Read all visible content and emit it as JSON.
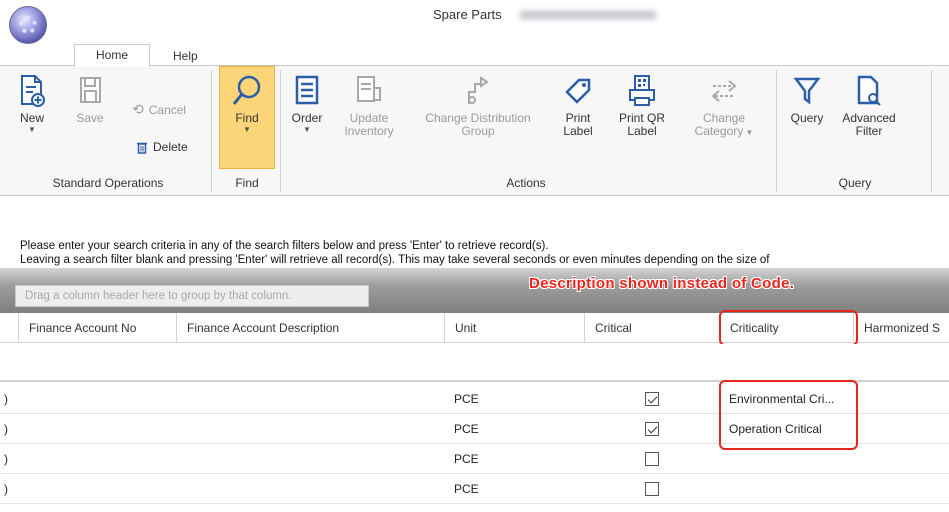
{
  "window": {
    "title": "Spare Parts",
    "app_icon": "gear-orb-icon"
  },
  "tabs": [
    {
      "label": "Home",
      "active": true
    },
    {
      "label": "Help",
      "active": false
    }
  ],
  "ribbon": {
    "standard_operations": {
      "group_label": "Standard Operations",
      "new": {
        "label": "New",
        "icon": "new-document-icon"
      },
      "save": {
        "label": "Save",
        "icon": "save-icon",
        "disabled": true
      },
      "cancel": {
        "label": "Cancel",
        "icon": "undo-icon",
        "disabled": true
      },
      "delete": {
        "label": "Delete",
        "icon": "trash-icon"
      }
    },
    "find": {
      "group_label": "Find",
      "find": {
        "label": "Find",
        "icon": "search-icon"
      }
    },
    "actions": {
      "group_label": "Actions",
      "order": {
        "label": "Order",
        "icon": "order-list-icon"
      },
      "update_inventory": {
        "label1": "Update",
        "label2": "Inventory",
        "icon": "update-inventory-icon",
        "disabled": true
      },
      "change_distribution_group": {
        "label1": "Change Distribution",
        "label2": "Group",
        "icon": "distribution-icon",
        "disabled": true
      },
      "print_label": {
        "label1": "Print",
        "label2": "Label",
        "icon": "tag-icon"
      },
      "print_qr_label": {
        "label1": "Print QR",
        "label2": "Label",
        "icon": "qr-printer-icon"
      },
      "change_category": {
        "label1": "Change",
        "label2": "Category",
        "icon": "swap-arrows-icon",
        "disabled": true
      }
    },
    "query": {
      "group_label": "Query",
      "query": {
        "label": "Query",
        "icon": "filter-funnel-icon"
      },
      "advanced_filter": {
        "label1": "Advanced",
        "label2": "Filter",
        "icon": "advanced-filter-icon"
      }
    }
  },
  "info": {
    "line1": "Please enter your search criteria in any of the search filters below and press  'Enter' to retrieve record(s).",
    "line2": "Leaving a search filter blank and pressing 'Enter'  will retrieve all record(s). This may take several seconds or even minutes depending on the size of"
  },
  "grid": {
    "group_hint": "Drag a column header here to group by that column.",
    "annotation": "Description shown instead of Code.",
    "columns": [
      "Finance Account No",
      "Finance Account Description",
      "Unit",
      "Critical",
      "Criticality",
      "Harmonized S"
    ],
    "rows": [
      {
        "lead": ")",
        "unit": "PCE",
        "critical": true,
        "criticality": "Environmental Cri..."
      },
      {
        "lead": ")",
        "unit": "PCE",
        "critical": true,
        "criticality": "Operation Critical"
      },
      {
        "lead": ")",
        "unit": "PCE",
        "critical": false,
        "criticality": ""
      },
      {
        "lead": ")",
        "unit": "PCE",
        "critical": false,
        "criticality": ""
      }
    ]
  },
  "colors": {
    "find_highlight": "#fbd577",
    "annotation_red": "#e8261e"
  }
}
